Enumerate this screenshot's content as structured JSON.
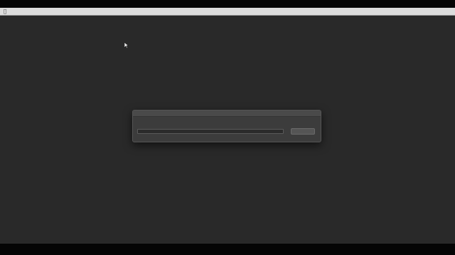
{
  "menubar": {
    "apple_icon": "apple-logo-icon",
    "items": [
      "",
      "",
      "",
      "",
      ""
    ],
    "status": ""
  },
  "dialog": {
    "title": "",
    "prompt": "",
    "input_value": "",
    "button_label": ""
  },
  "colors": {
    "desktop": "#292929",
    "menubar": "#dcdcdc",
    "dialog": "#3c3c3c"
  }
}
